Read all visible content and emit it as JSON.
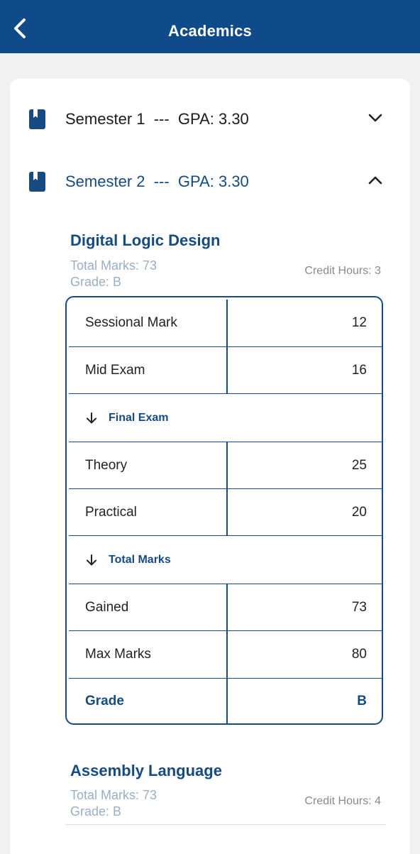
{
  "header": {
    "title": "Academics",
    "back_icon": "chevron-left-icon"
  },
  "colors": {
    "primary": "#0f4a8a",
    "accent": "#154a82",
    "muted": "#9aaec6",
    "background": "#f1f1f1"
  },
  "semesters": [
    {
      "title": "Semester 1  ---  GPA: 3.30",
      "expanded": false,
      "icon": "book-icon"
    },
    {
      "title": "Semester 2  ---  GPA: 3.30",
      "expanded": true,
      "icon": "book-icon"
    }
  ],
  "courses": [
    {
      "name": "Digital Logic Design",
      "total_marks": "Total Marks: 73",
      "grade": "Grade: B",
      "credit_hours": "Credit Hours: 3",
      "table": {
        "sessional": {
          "label": "Sessional Mark",
          "value": "12"
        },
        "mid": {
          "label": "Mid Exam",
          "value": "16"
        },
        "final_header": "Final Exam",
        "theory": {
          "label": "Theory",
          "value": "25"
        },
        "practical": {
          "label": "Practical",
          "value": "20"
        },
        "total_header": "Total Marks",
        "gained": {
          "label": "Gained",
          "value": "73"
        },
        "max": {
          "label": "Max Marks",
          "value": "80"
        },
        "grade": {
          "label": "Grade",
          "value": "B"
        }
      }
    },
    {
      "name": "Assembly Language",
      "total_marks": "Total Marks: 73",
      "grade": "Grade: B",
      "credit_hours": "Credit Hours: 4"
    }
  ]
}
